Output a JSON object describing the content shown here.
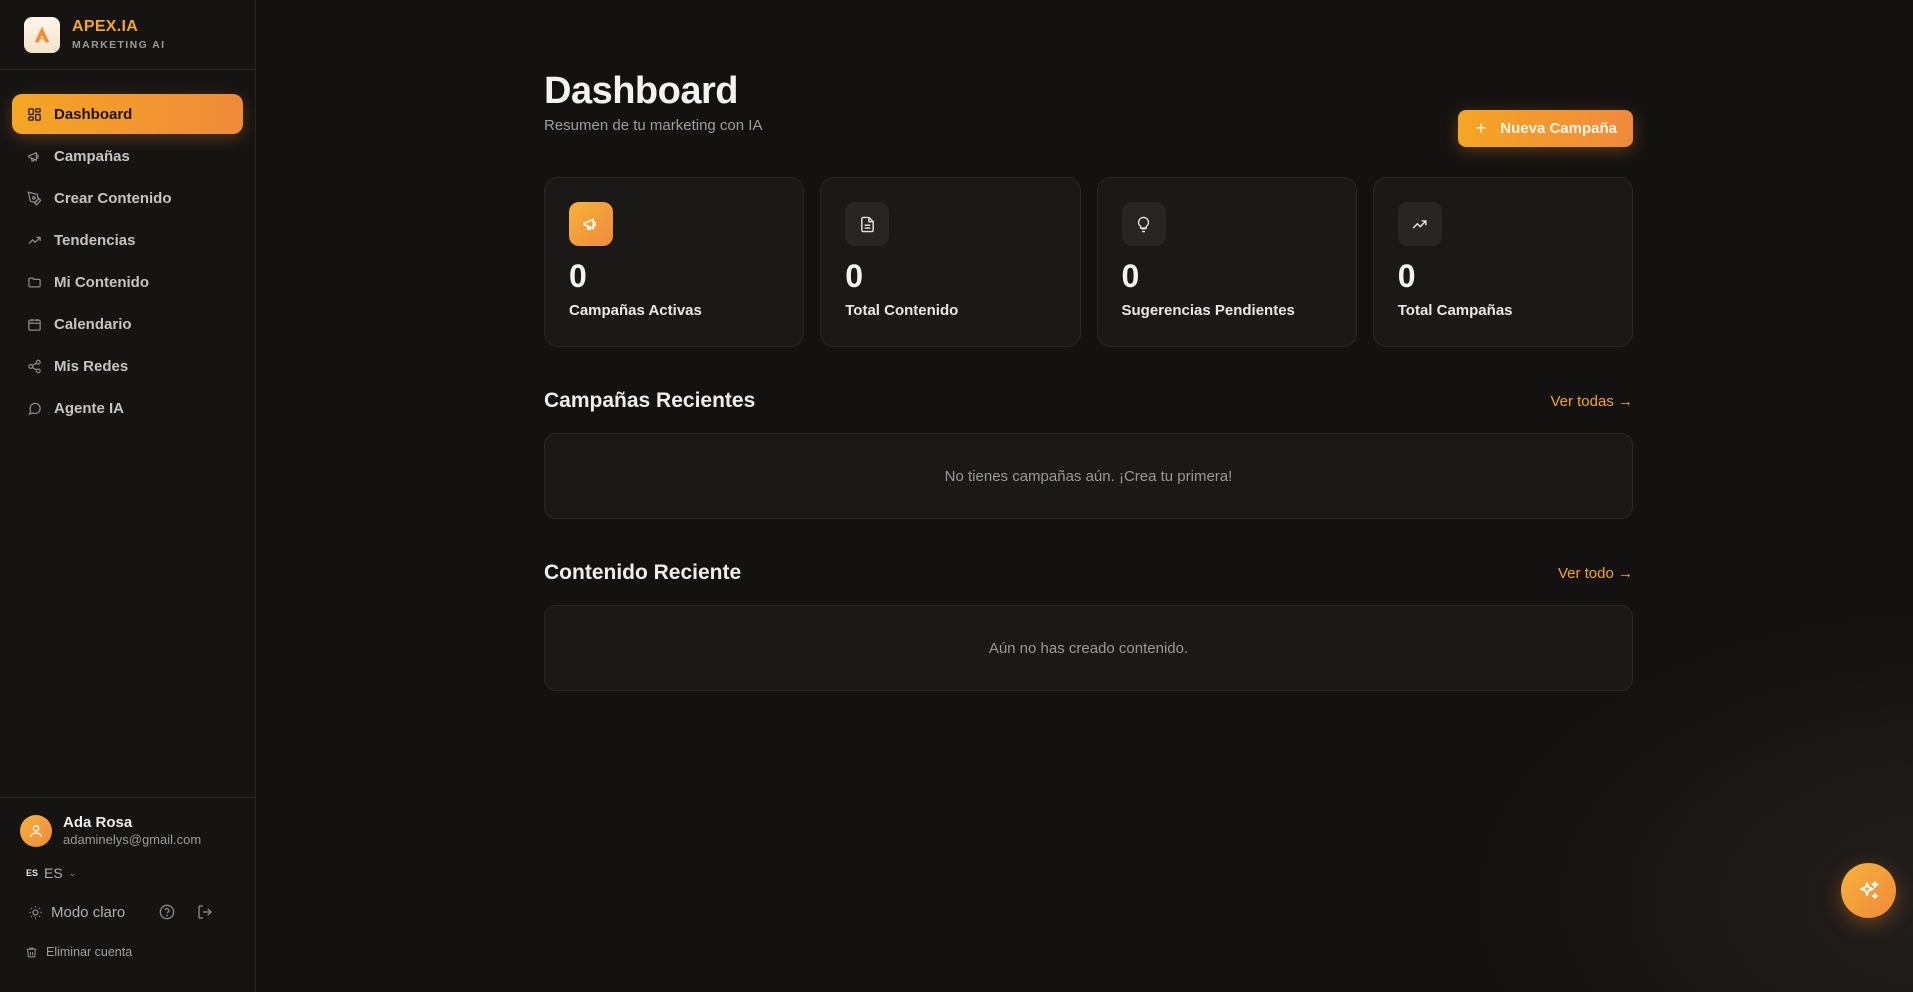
{
  "brand": {
    "name": "APEX.IA",
    "subtitle": "MARKETING AI",
    "logo_text": "APEX.IA"
  },
  "nav": [
    {
      "label": "Dashboard",
      "icon": "dashboard-grid-icon",
      "active": true
    },
    {
      "label": "Campañas",
      "icon": "megaphone-icon"
    },
    {
      "label": "Crear Contenido",
      "icon": "pen-tool-icon"
    },
    {
      "label": "Tendencias",
      "icon": "trending-up-icon"
    },
    {
      "label": "Mi Contenido",
      "icon": "folder-icon"
    },
    {
      "label": "Calendario",
      "icon": "calendar-icon"
    },
    {
      "label": "Mis Redes",
      "icon": "share-icon"
    },
    {
      "label": "Agente IA",
      "icon": "chat-icon"
    }
  ],
  "user": {
    "name": "Ada Rosa",
    "email": "adaminelys@gmail.com"
  },
  "language": {
    "flag": "ES",
    "code": "ES"
  },
  "footer": {
    "mode_label": "Modo claro",
    "delete_label": "Eliminar cuenta"
  },
  "header": {
    "title": "Dashboard",
    "subtitle": "Resumen de tu marketing con IA",
    "new_campaign": "Nueva Campaña"
  },
  "stats": [
    {
      "value": "0",
      "label": "Campañas Activas",
      "icon": "megaphone-icon"
    },
    {
      "value": "0",
      "label": "Total Contenido",
      "icon": "document-icon"
    },
    {
      "value": "0",
      "label": "Sugerencias Pendientes",
      "icon": "lightbulb-icon"
    },
    {
      "value": "0",
      "label": "Total Campañas",
      "icon": "trending-up-icon"
    }
  ],
  "recent_campaigns": {
    "title": "Campañas Recientes",
    "link": "Ver todas →",
    "empty": "No tienes campañas aún. ¡Crea tu primera!"
  },
  "recent_content": {
    "title": "Contenido Reciente",
    "link": "Ver todo →",
    "empty": "Aún no has creado contenido."
  },
  "colors": {
    "accent": "#f5a623",
    "accent_end": "#f08a3b",
    "background": "#141211",
    "card": "#1b1917"
  }
}
